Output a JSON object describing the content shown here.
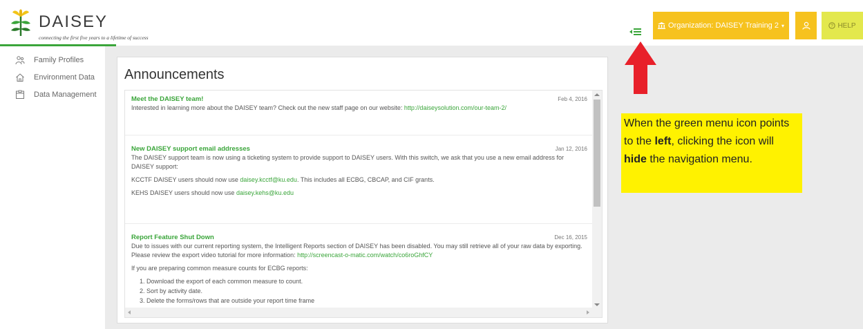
{
  "logo": {
    "word": "DAISEY",
    "tagline": "connecting the first five years to a lifetime of success"
  },
  "header": {
    "organization_label": "Organization: DAISEY Training 2",
    "help_label": "HELP"
  },
  "sidebar": {
    "items": [
      {
        "label": "Family Profiles",
        "icon": "family-icon"
      },
      {
        "label": "Environment Data",
        "icon": "home-icon"
      },
      {
        "label": "Data Management",
        "icon": "folder-icon"
      }
    ]
  },
  "main": {
    "title": "Announcements",
    "announcements": [
      {
        "title": "Meet the DAISEY team!",
        "date": "Feb 4, 2016",
        "body": "Interested in learning more about the DAISEY team? Check out the new staff page on our website:",
        "link": "http://daiseysolution.com/our-team-2/"
      },
      {
        "title": "New DAISEY support email addresses",
        "date": "Jan 12, 2016",
        "body": "The DAISEY support team is now using a ticketing system to provide support to DAISEY users. With this switch, we ask that you use a new email address for DAISEY support:",
        "line2_pre": "KCCTF DAISEY users should now use",
        "line2_link": "daisey.kcctf@ku.edu",
        "line2_post": ". This includes all ECBG, CBCAP, and CIF grants.",
        "line3_pre": "KEHS DAISEY users should now use",
        "line3_link": "daisey.kehs@ku.edu"
      },
      {
        "title": "Report Feature Shut Down",
        "date": "Dec 16, 2015",
        "body": "Due to issues with our current reporting system, the Intelligent Reports section of DAISEY has been disabled. You may still retrieve all of your raw data by exporting. Please review the export video tutorial for more information:",
        "link": "http://screencast-o-matic.com/watch/co6roGhfCY",
        "line2": "If you are preparing common measure counts for ECBG reports:",
        "steps": [
          "Download the export of each common measure to count.",
          "Sort by activity date.",
          "Delete the forms/rows that are outside your report time frame"
        ]
      }
    ]
  },
  "callout": {
    "t1": "When the green menu icon points to the ",
    "b1": "left",
    "t2": ", clicking the icon will ",
    "b2": "hide",
    "t3": " the navigation menu."
  },
  "colors": {
    "accent_green": "#3aa53a",
    "org_button": "#f6c21e",
    "help_button": "#e3e84d",
    "callout_bg": "#fff200",
    "arrow_red": "#e8202a"
  }
}
